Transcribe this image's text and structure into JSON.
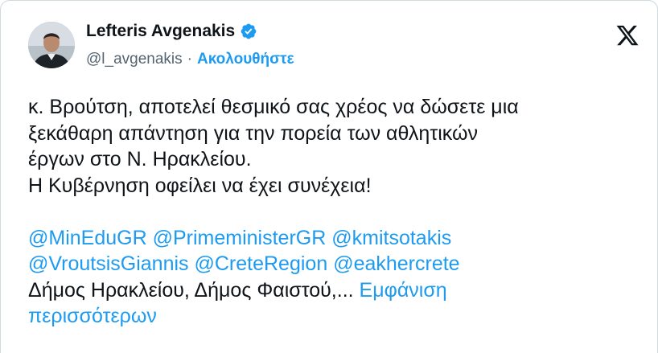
{
  "author": {
    "name": "Lefteris Avgenakis",
    "handle": "@l_avgenakis",
    "separator": "·",
    "follow_label": "Ακολουθήστε",
    "verified_badge_icon": "verified-badge-icon",
    "avatar_icon": "avatar"
  },
  "platform_icon": "x-logo-icon",
  "tweet": {
    "lines": [
      "κ. Βρούτση, αποτελεί θεσμικό σας χρέος να δώσετε μια",
      "ξεκάθαρη απάντηση για την πορεία των αθλητικών",
      "έργων στο Ν. Ηρακλείου.",
      "Η Κυβέρνηση οφείλει να έχει συνέχεια!"
    ],
    "mentions": {
      "m1": "@MinEduGR",
      "m2": "@PrimeministerGR",
      "m3": "@kmitsotakis",
      "m4": "@VroutsisGiannis",
      "m5": "@CreteRegion",
      "m6": "@eakhercrete"
    },
    "trailing_text": "Δήμος Ηρακλείου, Δήμος Φαιστού,...",
    "show_more_part1": "Εμφάνιση",
    "show_more_part2": "περισσότερων"
  },
  "colors": {
    "accent": "#1d9bf0",
    "text": "#0f1419",
    "secondary": "#536471",
    "border": "#cfd9de"
  }
}
